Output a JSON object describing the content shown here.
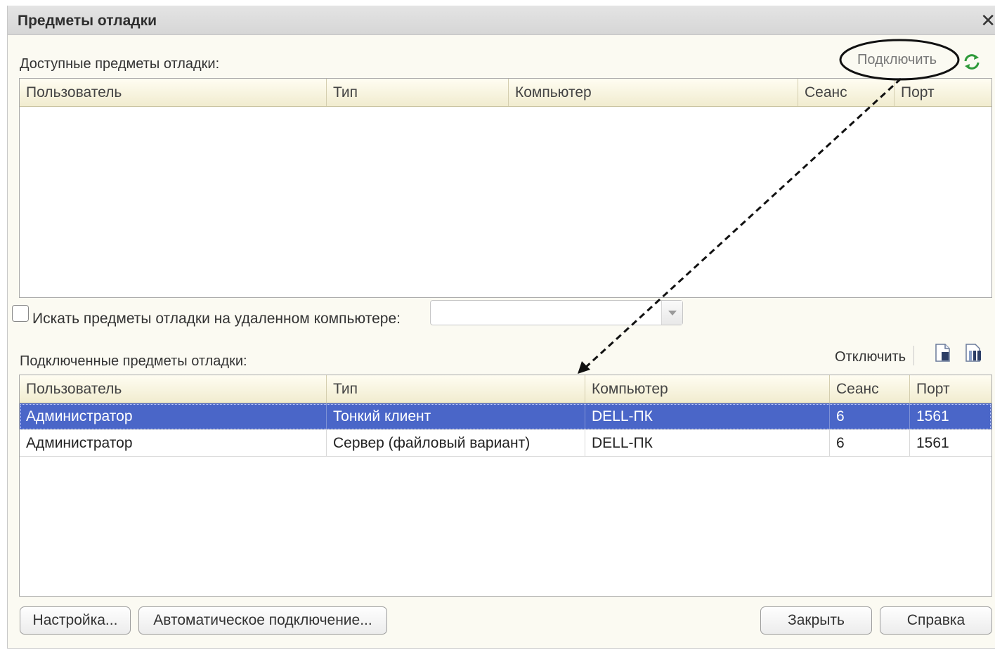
{
  "window": {
    "title": "Предметы отладки",
    "close_glyph": "✕"
  },
  "available": {
    "label": "Доступные предметы отладки:",
    "connect_button": "Подключить",
    "refresh_icon": "refresh-icon",
    "columns": [
      "Пользователь",
      "Тип",
      "Компьютер",
      "Сеанс",
      "Порт"
    ],
    "rows": []
  },
  "search_remote": {
    "checkbox_label": "Искать предметы отладки на удаленном компьютере:",
    "checked": false,
    "combo_value": ""
  },
  "connected": {
    "label": "Подключенные предметы отладки:",
    "disconnect_button": "Отключить",
    "toolbar_icons": [
      "document-icon",
      "columns-icon"
    ],
    "columns": [
      "Пользователь",
      "Тип",
      "Компьютер",
      "Сеанс",
      "Порт"
    ],
    "rows": [
      {
        "user": "Администратор",
        "type": "Тонкий клиент",
        "computer": "DELL-ПК",
        "session": "6",
        "port": "1561",
        "selected": true
      },
      {
        "user": "Администратор",
        "type": "Сервер (файловый вариант)",
        "computer": "DELL-ПК",
        "session": "6",
        "port": "1561",
        "selected": false
      }
    ]
  },
  "footer": {
    "settings_button": "Настройка...",
    "auto_connect_button": "Автоматическое подключение...",
    "close_button": "Закрыть",
    "help_button": "Справка"
  },
  "colors": {
    "selection": "#4a66c8",
    "header_bg": "#f5f1dc",
    "refresh_green": "#2e9a3a",
    "window_bg": "#fbfaf2"
  }
}
